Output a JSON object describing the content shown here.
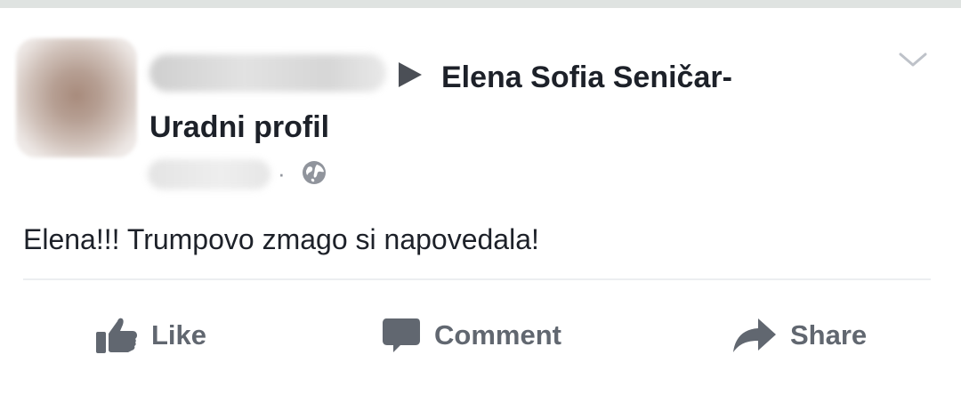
{
  "post": {
    "target": "Elena Sofia Seničar-Uradni profil",
    "separator": "·",
    "text": "Elena!!! Trumpovo zmago si napovedala!",
    "privacy_icon": "globe-icon",
    "menu_icon": "chevron-down-icon"
  },
  "actions": {
    "like": "Like",
    "comment": "Comment",
    "share": "Share"
  },
  "colors": {
    "text": "#1d2129",
    "muted": "#616770",
    "icon": "#616770"
  }
}
